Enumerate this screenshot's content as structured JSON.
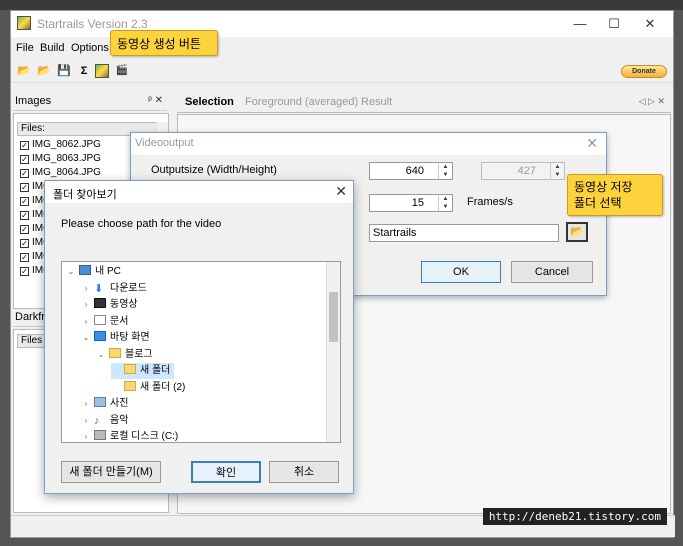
{
  "app": {
    "title": "Startrails Version 2.3",
    "window_controls": [
      "—",
      "☐",
      "✕"
    ],
    "menu": [
      "File",
      "Build",
      "Options"
    ],
    "donate_label": "Donate"
  },
  "callouts": {
    "video_button": "동영상 생성 버튼",
    "folder_select_line1": "동영상 저장",
    "folder_select_line2": "폴더 선택"
  },
  "images_panel": {
    "title": "Images",
    "files_header": "Files:",
    "files": [
      "IMG_8062.JPG",
      "IMG_8063.JPG",
      "IMG_8064.JPG",
      "IMG",
      "IMG",
      "IMG",
      "IMG",
      "IMG",
      "IMG",
      "IMG"
    ]
  },
  "darkframes_panel": {
    "title": "Darkfra",
    "files_header": "Files"
  },
  "tabs": [
    "Selection",
    "Foreground (averaged)",
    "Result"
  ],
  "video_dialog": {
    "title": "Videooutput",
    "outputsize_label": "Outputsize (Width/Height)",
    "width_value": "640",
    "height_value": "427",
    "fps_value": "15",
    "fps_label": "Frames/s",
    "name_value": "Startrails",
    "ok_label": "OK",
    "cancel_label": "Cancel"
  },
  "folder_dialog": {
    "title": "폴더 찾아보기",
    "prompt": "Please choose path for the video",
    "tree": [
      {
        "label": "내 PC",
        "icon": "pc-icon",
        "level": 0,
        "expanded": true
      },
      {
        "label": "다운로드",
        "icon": "download-icon",
        "level": 1,
        "expanded": false
      },
      {
        "label": "동영상",
        "icon": "video-icon",
        "level": 1,
        "expanded": false
      },
      {
        "label": "문서",
        "icon": "document-icon",
        "level": 1,
        "expanded": false
      },
      {
        "label": "바탕 화면",
        "icon": "desktop-icon",
        "level": 1,
        "expanded": true
      },
      {
        "label": "블로그",
        "icon": "folder-icon",
        "level": 2,
        "expanded": true
      },
      {
        "label": "새 폴더",
        "icon": "folder-icon",
        "level": 3,
        "selected": true
      },
      {
        "label": "새 폴더 (2)",
        "icon": "folder-icon",
        "level": 3
      },
      {
        "label": "사진",
        "icon": "picture-icon",
        "level": 1,
        "expanded": false
      },
      {
        "label": "음악",
        "icon": "music-icon",
        "level": 1,
        "expanded": false
      },
      {
        "label": "로컬 디스크 (C:)",
        "icon": "disk-icon",
        "level": 1,
        "expanded": false
      }
    ],
    "new_folder_label": "새 폴더 만들기(M)",
    "confirm_label": "확인",
    "cancel_label": "취소"
  },
  "watermark": "http://deneb21.tistory.com"
}
